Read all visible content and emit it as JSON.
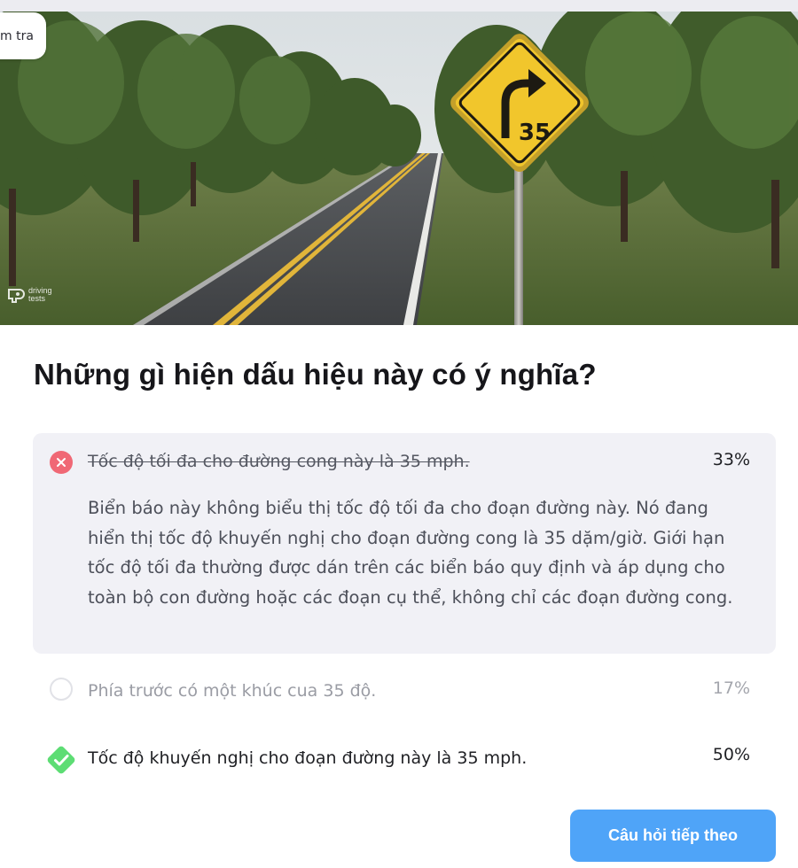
{
  "header": {
    "badge_label": "m tra"
  },
  "hero": {
    "sign_text": "35",
    "watermark_line1": "driving",
    "watermark_line2": "tests"
  },
  "question": {
    "text": "Những gì hiện dấu hiệu này có ý nghĩa?"
  },
  "answers": [
    {
      "state": "wrong",
      "label": "Tốc độ tối đa cho đường cong này là 35 mph.",
      "percent": "33%",
      "explanation": "Biển báo này không biểu thị tốc độ tối đa cho đoạn đường này. Nó đang hiển thị tốc độ khuyến nghị cho đoạn đường cong là 35 dặm/giờ. Giới hạn tốc độ tối đa thường được dán trên các biển báo quy định và áp dụng cho toàn bộ con đường hoặc các đoạn cụ thể, không chỉ các đoạn đường cong."
    },
    {
      "state": "unselected",
      "label": "Phía trước có một khúc cua 35 độ.",
      "percent": "17%"
    },
    {
      "state": "correct",
      "label": "Tốc độ khuyến nghị cho đoạn đường này là 35 mph.",
      "percent": "50%"
    }
  ],
  "next_button": {
    "label": "Câu hỏi tiếp theo"
  },
  "colors": {
    "wrong": "#f06875",
    "correct": "#5ddd74",
    "primary": "#4fa4f8",
    "answer_bg": "#f1f1f6"
  }
}
